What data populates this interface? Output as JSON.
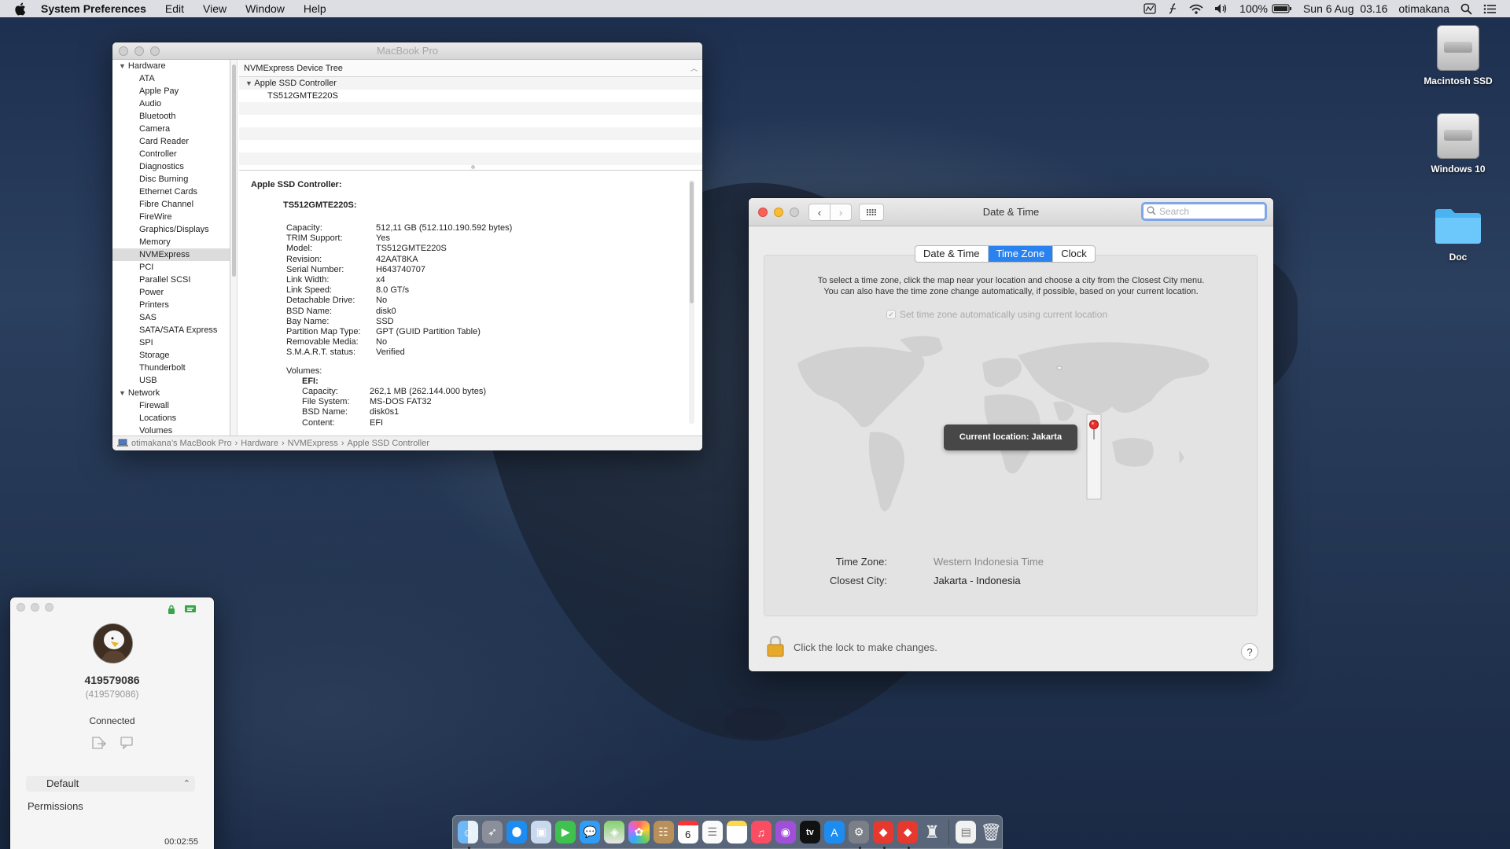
{
  "menubar": {
    "app_name": "System Preferences",
    "menus": [
      "Edit",
      "View",
      "Window",
      "Help"
    ],
    "battery": "100%",
    "datetime": "Sun 6 Aug  03.16",
    "user": "otimakana"
  },
  "sysinfo": {
    "window_title": "MacBook Pro",
    "sidebar": {
      "hardware_label": "Hardware",
      "hardware_items": [
        "ATA",
        "Apple Pay",
        "Audio",
        "Bluetooth",
        "Camera",
        "Card Reader",
        "Controller",
        "Diagnostics",
        "Disc Burning",
        "Ethernet Cards",
        "Fibre Channel",
        "FireWire",
        "Graphics/Displays",
        "Memory",
        "NVMExpress",
        "PCI",
        "Parallel SCSI",
        "Power",
        "Printers",
        "SAS",
        "SATA/SATA Express",
        "SPI",
        "Storage",
        "Thunderbolt",
        "USB"
      ],
      "selected": "NVMExpress",
      "network_label": "Network",
      "network_items": [
        "Firewall",
        "Locations",
        "Volumes"
      ]
    },
    "tree_header": "NVMExpress Device Tree",
    "tree_rows": [
      "Apple SSD Controller",
      "TS512GMTE220S"
    ],
    "detail": {
      "heading": "Apple SSD Controller:",
      "device": "TS512GMTE220S:",
      "fields": [
        {
          "k": "Capacity:",
          "v": "512,11 GB (512.110.190.592 bytes)"
        },
        {
          "k": "TRIM Support:",
          "v": "Yes"
        },
        {
          "k": "Model:",
          "v": "TS512GMTE220S"
        },
        {
          "k": "Revision:",
          "v": "42AAT8KA"
        },
        {
          "k": "Serial Number:",
          "v": "H643740707"
        },
        {
          "k": "Link Width:",
          "v": "x4"
        },
        {
          "k": "Link Speed:",
          "v": "8.0 GT/s"
        },
        {
          "k": "Detachable Drive:",
          "v": "No"
        },
        {
          "k": "BSD Name:",
          "v": "disk0"
        },
        {
          "k": "Bay Name:",
          "v": "SSD"
        },
        {
          "k": "Partition Map Type:",
          "v": "GPT (GUID Partition Table)"
        },
        {
          "k": "Removable Media:",
          "v": "No"
        },
        {
          "k": "S.M.A.R.T. status:",
          "v": "Verified"
        }
      ],
      "volumes_label": "Volumes:",
      "efi_label": "EFI:",
      "efi_fields": [
        {
          "k": "Capacity:",
          "v": "262,1 MB (262.144.000 bytes)"
        },
        {
          "k": "File System:",
          "v": "MS-DOS FAT32"
        },
        {
          "k": "BSD Name:",
          "v": "disk0s1"
        },
        {
          "k": "Content:",
          "v": "EFI"
        }
      ]
    },
    "path": [
      "otimakana’s MacBook Pro",
      "Hardware",
      "NVMExpress",
      "Apple SSD Controller"
    ]
  },
  "datetime_win": {
    "title": "Date & Time",
    "search_placeholder": "Search",
    "tabs": [
      "Date & Time",
      "Time Zone",
      "Clock"
    ],
    "active_tab": "Time Zone",
    "instr_line1": "To select a time zone, click the map near your location and choose a city from the Closest City menu.",
    "instr_line2": "You can also have the time zone change automatically, if possible, based on your current location.",
    "auto_label": "Set time zone automatically using current location",
    "tooltip": "Current location: Jakarta",
    "tz_label": "Time Zone:",
    "tz_value": "Western Indonesia Time",
    "city_label": "Closest City:",
    "city_value": "Jakarta - Indonesia",
    "lock_text": "Click the lock to make changes.",
    "help": "?"
  },
  "mini_app": {
    "id": "419579086",
    "id_sub": "(419579086)",
    "status": "Connected",
    "select_value": "Default",
    "permissions": "Permissions",
    "timer": "00:02:55"
  },
  "desktop_icons": [
    "Macintosh SSD",
    "Windows 10",
    "Doc"
  ],
  "dock_icons": [
    "finder-icon",
    "launchpad-icon",
    "safari-icon",
    "preview-icon",
    "facetime-icon",
    "messages-icon",
    "maps-icon",
    "photos-icon",
    "contacts-icon",
    "calendar-icon",
    "reminders-icon",
    "notes-icon",
    "music-icon",
    "podcasts-icon",
    "tv-icon",
    "app-store-icon",
    "system-preferences-icon",
    "anydesk-icon",
    "anydesk-alt-icon",
    "automator-icon",
    "documents-icon",
    "trash-icon"
  ],
  "calendar_day": "6",
  "tv_label": "tv",
  "colors": {
    "accent": "#2a82ef",
    "pin": "#e5322d"
  }
}
